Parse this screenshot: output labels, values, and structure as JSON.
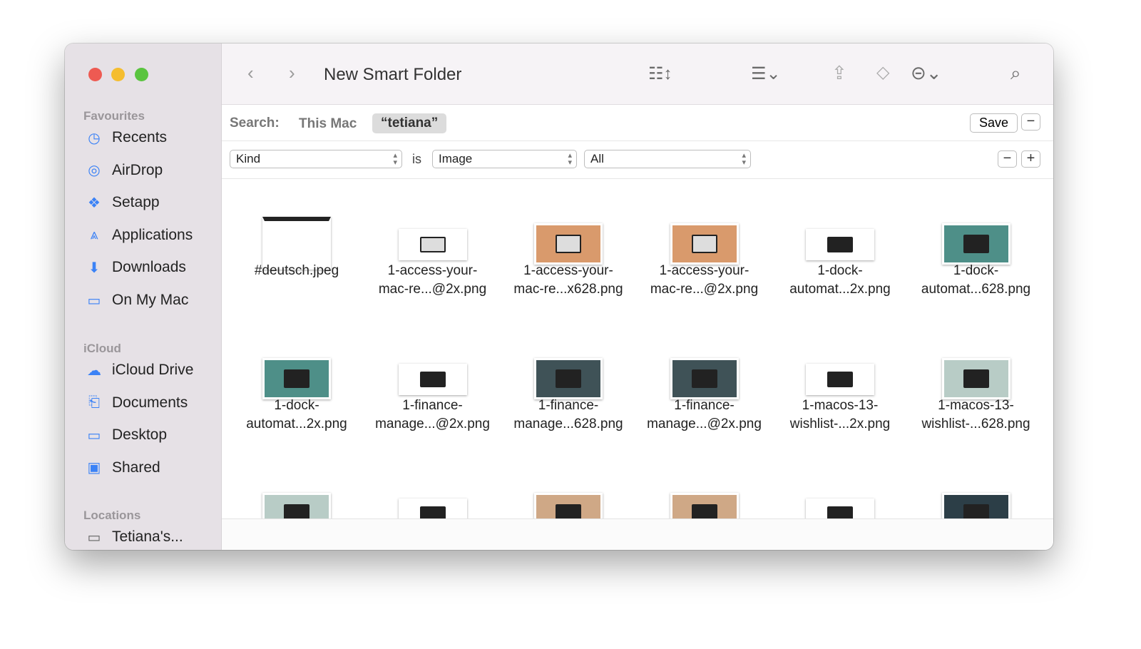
{
  "window": {
    "title": "New Smart Folder"
  },
  "sidebar": {
    "sections": [
      {
        "title": "Favourites",
        "items": [
          {
            "label": "Recents",
            "icon": "clock-icon"
          },
          {
            "label": "AirDrop",
            "icon": "airdrop-icon"
          },
          {
            "label": "Setapp",
            "icon": "setapp-icon"
          },
          {
            "label": "Applications",
            "icon": "applications-icon"
          },
          {
            "label": "Downloads",
            "icon": "download-icon"
          },
          {
            "label": "On My Mac",
            "icon": "folder-icon"
          }
        ]
      },
      {
        "title": "iCloud",
        "items": [
          {
            "label": "iCloud Drive",
            "icon": "cloud-icon"
          },
          {
            "label": "Documents",
            "icon": "document-icon"
          },
          {
            "label": "Desktop",
            "icon": "desktop-icon"
          },
          {
            "label": "Shared",
            "icon": "shared-folder-icon"
          }
        ]
      },
      {
        "title": "Locations",
        "items": [
          {
            "label": "Tetiana's...",
            "icon": "laptop-icon"
          }
        ]
      }
    ]
  },
  "search": {
    "label": "Search:",
    "scope_this_mac": "This Mac",
    "scope_query": "“tetiana”",
    "save": "Save",
    "minus": "−"
  },
  "criteria": {
    "attribute": "Kind",
    "operator": "is",
    "value": "Image",
    "subvalue": "All",
    "minus": "−",
    "plus": "+"
  },
  "files": [
    {
      "line1": "#deutsch.jpeg",
      "line2": "",
      "bg": "#ffffff"
    },
    {
      "line1": "1-access-your-",
      "line2": "mac-re...@2x.png",
      "bg": "#ffffff"
    },
    {
      "line1": "1-access-your-",
      "line2": "mac-re...x628.png",
      "bg": "#d99a6c"
    },
    {
      "line1": "1-access-your-",
      "line2": "mac-re...@2x.png",
      "bg": "#d99a6c"
    },
    {
      "line1": "1-dock-",
      "line2": "automat...2x.png",
      "bg": "#ffffff"
    },
    {
      "line1": "1-dock-",
      "line2": "automat...628.png",
      "bg": "#4e8f88"
    },
    {
      "line1": "1-dock-",
      "line2": "automat...2x.png",
      "bg": "#4e8f88"
    },
    {
      "line1": "1-finance-",
      "line2": "manage...@2x.png",
      "bg": "#ffffff"
    },
    {
      "line1": "1-finance-",
      "line2": "manage...628.png",
      "bg": "#3f5257"
    },
    {
      "line1": "1-finance-",
      "line2": "manage...@2x.png",
      "bg": "#3f5257"
    },
    {
      "line1": "1-macos-13-",
      "line2": "wishlist-...2x.png",
      "bg": "#ffffff"
    },
    {
      "line1": "1-macos-13-",
      "line2": "wishlist-...628.png",
      "bg": "#b8ccc6"
    },
    {
      "line1": "",
      "line2": "",
      "bg": "#b8ccc6"
    },
    {
      "line1": "",
      "line2": "",
      "bg": "#ffffff"
    },
    {
      "line1": "",
      "line2": "",
      "bg": "#cfa886"
    },
    {
      "line1": "",
      "line2": "",
      "bg": "#cfa886"
    },
    {
      "line1": "",
      "line2": "",
      "bg": "#ffffff"
    },
    {
      "line1": "",
      "line2": "",
      "bg": "#2c3e47"
    }
  ]
}
